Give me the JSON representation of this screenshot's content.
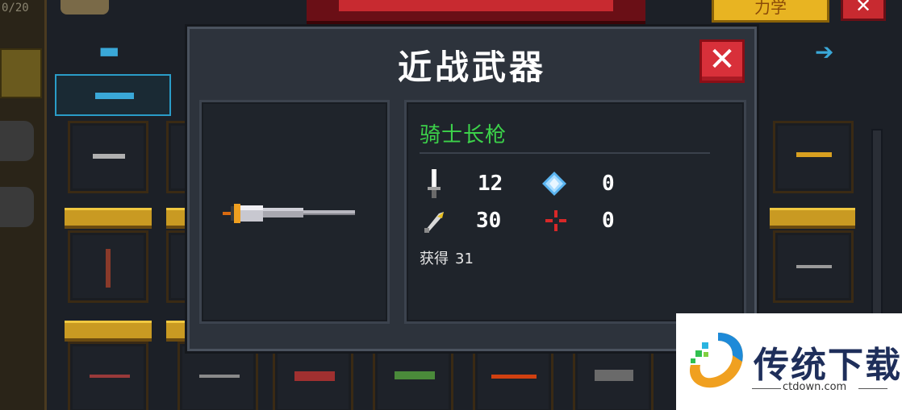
{
  "background": {
    "counter": "0/20",
    "top_button_label": "力学",
    "top_close_label": "✕",
    "left_arrow": "⇐",
    "right_arrow": "➔"
  },
  "modal": {
    "title": "近战武器",
    "close_label": "✕",
    "weapon": {
      "name": "骑士长枪",
      "stats": {
        "damage": "12",
        "energy_cost": "0",
        "critical": "30",
        "inaccuracy": "0"
      },
      "obtained_label": "获得",
      "obtained_count": "31"
    }
  },
  "watermark": {
    "brand": "传统下载",
    "url": "ctdown.com"
  },
  "colors": {
    "weapon_name": "#3cd24a",
    "close_button": "#d8303a",
    "modal_bg": "#2d333c",
    "panel_bg": "#1f242b"
  }
}
